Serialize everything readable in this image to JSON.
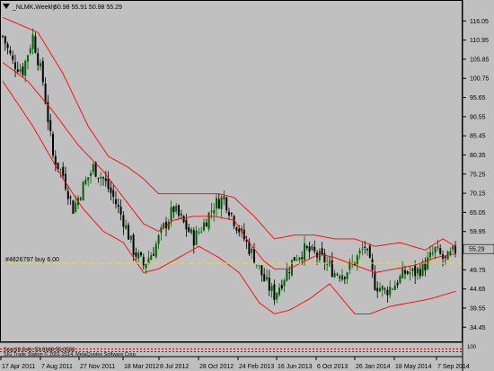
{
  "header": {
    "symbol_label": "_NLMK,Weekly",
    "ohlc_text": "50.98 55.91 50.98 55.29"
  },
  "order_line": {
    "label": "#4826797 buy 6.00",
    "price": 51.5,
    "color": "#e6e600"
  },
  "subwindow": {
    "label": "Sco(10,3,4): 53.0168 55.0533"
  },
  "copyright": "SIG Trade Station © 2001-2014, MetaQuotes Software Corp.",
  "colors": {
    "background": "#c0c0c0",
    "bull_candle": "#006400",
    "bear_candle": "#000000",
    "bollinger": "#ff0000",
    "current_price_box": "#c0c0c0"
  },
  "chart_data": {
    "type": "candlestick",
    "title": "_NLMK,Weekly",
    "price_ticks": [
      116.05,
      110.95,
      105.85,
      100.75,
      95.65,
      90.55,
      85.45,
      80.35,
      75.25,
      70.15,
      65.05,
      59.95,
      55.29,
      49.75,
      44.65,
      39.55,
      34.45
    ],
    "current_price": 55.29,
    "ylim": [
      32.6,
      117.8
    ],
    "date_ticks": [
      "17 Apr 2011",
      "7 Aug 2011",
      "27 Nov 2011",
      "18 Mar 2012",
      "8 Jul 2012",
      "28 Oct 2012",
      "24 Feb 2013",
      "16 Jun 2013",
      "6 Oct 2013",
      "26 Jan 2014",
      "18 May 2014",
      "7 Sep 2014"
    ],
    "close_path": [
      [
        0,
        112
      ],
      [
        4,
        105
      ],
      [
        8,
        103
      ],
      [
        12,
        112
      ],
      [
        16,
        100
      ],
      [
        20,
        80
      ],
      [
        24,
        75
      ],
      [
        28,
        66
      ],
      [
        32,
        72
      ],
      [
        36,
        77
      ],
      [
        40,
        74
      ],
      [
        44,
        69
      ],
      [
        48,
        63
      ],
      [
        52,
        55
      ],
      [
        56,
        51
      ],
      [
        60,
        55
      ],
      [
        64,
        61
      ],
      [
        68,
        66
      ],
      [
        72,
        62
      ],
      [
        76,
        58
      ],
      [
        80,
        62
      ],
      [
        84,
        67
      ],
      [
        88,
        69
      ],
      [
        92,
        63
      ],
      [
        96,
        58
      ],
      [
        100,
        53
      ],
      [
        104,
        47
      ],
      [
        108,
        43
      ],
      [
        112,
        48
      ],
      [
        116,
        53
      ],
      [
        120,
        55
      ],
      [
        124,
        54
      ],
      [
        128,
        52
      ],
      [
        132,
        49
      ],
      [
        136,
        49
      ],
      [
        140,
        52
      ],
      [
        144,
        56
      ],
      [
        148,
        46
      ],
      [
        152,
        44
      ],
      [
        156,
        46
      ],
      [
        160,
        49
      ],
      [
        164,
        49
      ],
      [
        168,
        51
      ],
      [
        172,
        55
      ],
      [
        176,
        52
      ],
      [
        180,
        55
      ]
    ],
    "bollinger_upper": [
      [
        0,
        117
      ],
      [
        14,
        113
      ],
      [
        24,
        102
      ],
      [
        34,
        88
      ],
      [
        42,
        80
      ],
      [
        50,
        77
      ],
      [
        56,
        74
      ],
      [
        62,
        70
      ],
      [
        70,
        70
      ],
      [
        78,
        70
      ],
      [
        86,
        70
      ],
      [
        92,
        69
      ],
      [
        100,
        64
      ],
      [
        108,
        58
      ],
      [
        116,
        59
      ],
      [
        124,
        59
      ],
      [
        132,
        58
      ],
      [
        140,
        58
      ],
      [
        148,
        56
      ],
      [
        158,
        57
      ],
      [
        168,
        55
      ],
      [
        175,
        58
      ],
      [
        180,
        56
      ]
    ],
    "bollinger_middle": [
      [
        0,
        105
      ],
      [
        10,
        100
      ],
      [
        20,
        92
      ],
      [
        30,
        83
      ],
      [
        40,
        76
      ],
      [
        48,
        69
      ],
      [
        56,
        62
      ],
      [
        62,
        60
      ],
      [
        68,
        63
      ],
      [
        76,
        64
      ],
      [
        84,
        64
      ],
      [
        92,
        63
      ],
      [
        98,
        57
      ],
      [
        104,
        52
      ],
      [
        108,
        50
      ],
      [
        114,
        50
      ],
      [
        120,
        52
      ],
      [
        126,
        54
      ],
      [
        132,
        53
      ],
      [
        140,
        51
      ],
      [
        148,
        49
      ],
      [
        156,
        50
      ],
      [
        164,
        51
      ],
      [
        172,
        53
      ],
      [
        180,
        54
      ]
    ],
    "bollinger_lower": [
      [
        0,
        100
      ],
      [
        12,
        88
      ],
      [
        24,
        74
      ],
      [
        32,
        66
      ],
      [
        40,
        60
      ],
      [
        48,
        57
      ],
      [
        56,
        49
      ],
      [
        62,
        50
      ],
      [
        70,
        53
      ],
      [
        78,
        56
      ],
      [
        86,
        53
      ],
      [
        94,
        49
      ],
      [
        102,
        41
      ],
      [
        108,
        38
      ],
      [
        114,
        39
      ],
      [
        122,
        42
      ],
      [
        130,
        46
      ],
      [
        140,
        38
      ],
      [
        146,
        38
      ],
      [
        154,
        40
      ],
      [
        162,
        41
      ],
      [
        170,
        42
      ],
      [
        180,
        44
      ]
    ]
  }
}
